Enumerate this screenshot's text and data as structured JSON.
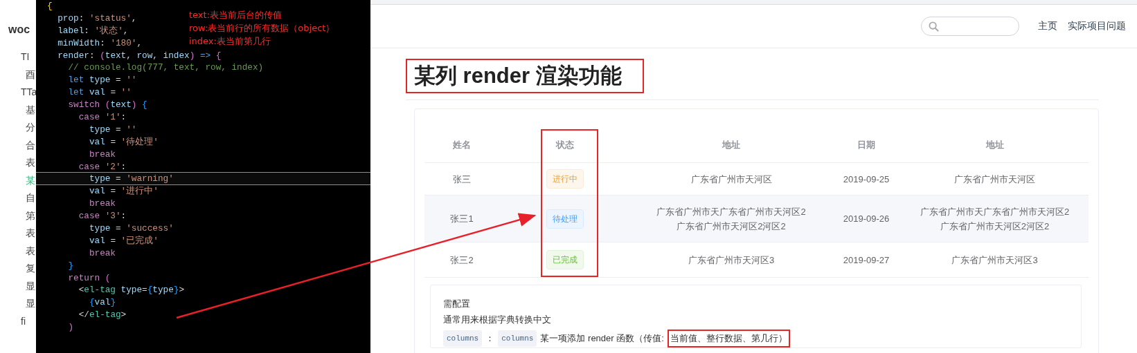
{
  "sidebar": {
    "logo": "woc",
    "items": [
      {
        "text": "TI",
        "selected": false
      },
      {
        "text": "酉",
        "selected": false
      },
      {
        "text": "TTa",
        "selected": false
      },
      {
        "text": "基",
        "selected": false
      },
      {
        "text": "分",
        "selected": false
      },
      {
        "text": "合",
        "selected": false
      },
      {
        "text": "表",
        "selected": false
      },
      {
        "text": "某",
        "selected": true
      },
      {
        "text": "自",
        "selected": false
      },
      {
        "text": "第",
        "selected": false
      },
      {
        "text": "表",
        "selected": false
      },
      {
        "text": "表",
        "selected": false
      },
      {
        "text": "复",
        "selected": false
      },
      {
        "text": "显",
        "selected": false
      },
      {
        "text": "显",
        "selected": false
      },
      {
        "text": "fi",
        "selected": false
      }
    ]
  },
  "editor": {
    "lines": [
      {
        "current": false,
        "tokens": [
          {
            "text": "{",
            "kind": "b1"
          }
        ]
      },
      {
        "current": false,
        "tokens": [
          {
            "text": "  prop",
            "kind": "k"
          },
          {
            "text": ": ",
            "kind": "p"
          },
          {
            "text": "'status'",
            "kind": "s"
          },
          {
            "text": ",",
            "kind": "p"
          }
        ]
      },
      {
        "current": false,
        "tokens": [
          {
            "text": "  label",
            "kind": "k"
          },
          {
            "text": ": ",
            "kind": "p"
          },
          {
            "text": "'状态'",
            "kind": "s"
          },
          {
            "text": ",",
            "kind": "p"
          }
        ]
      },
      {
        "current": false,
        "tokens": [
          {
            "text": "  minWidth",
            "kind": "k"
          },
          {
            "text": ": ",
            "kind": "p"
          },
          {
            "text": "'180'",
            "kind": "s"
          },
          {
            "text": ",",
            "kind": "p"
          }
        ]
      },
      {
        "current": false,
        "tokens": [
          {
            "text": "  render",
            "kind": "k"
          },
          {
            "text": ": ",
            "kind": "p"
          },
          {
            "text": "(",
            "kind": "b2"
          },
          {
            "text": "text",
            "kind": "k"
          },
          {
            "text": ", ",
            "kind": "p"
          },
          {
            "text": "row",
            "kind": "k"
          },
          {
            "text": ", ",
            "kind": "p"
          },
          {
            "text": "index",
            "kind": "k"
          },
          {
            "text": ")",
            "kind": "b2"
          },
          {
            "text": " => ",
            "kind": "kw"
          },
          {
            "text": "{",
            "kind": "b2"
          }
        ]
      },
      {
        "current": false,
        "tokens": [
          {
            "text": "    // console.log(777, text, row, index)",
            "kind": "c"
          }
        ]
      },
      {
        "current": false,
        "tokens": [
          {
            "text": "    let",
            "kind": "kw"
          },
          {
            "text": " type",
            "kind": "k"
          },
          {
            "text": " = ",
            "kind": "p"
          },
          {
            "text": "''",
            "kind": "s"
          }
        ]
      },
      {
        "current": false,
        "tokens": [
          {
            "text": "    let",
            "kind": "kw"
          },
          {
            "text": " val",
            "kind": "k"
          },
          {
            "text": " = ",
            "kind": "p"
          },
          {
            "text": "''",
            "kind": "s"
          }
        ]
      },
      {
        "current": false,
        "tokens": [
          {
            "text": "    switch",
            "kind": "ctl"
          },
          {
            "text": " (",
            "kind": "b2"
          },
          {
            "text": "text",
            "kind": "k"
          },
          {
            "text": ") ",
            "kind": "b2"
          },
          {
            "text": "{",
            "kind": "b3"
          }
        ]
      },
      {
        "current": false,
        "tokens": [
          {
            "text": "      case",
            "kind": "ctl"
          },
          {
            "text": " '1'",
            "kind": "s"
          },
          {
            "text": ":",
            "kind": "p"
          }
        ]
      },
      {
        "current": false,
        "tokens": [
          {
            "text": "        type",
            "kind": "k"
          },
          {
            "text": " = ",
            "kind": "p"
          },
          {
            "text": "''",
            "kind": "s"
          }
        ]
      },
      {
        "current": false,
        "tokens": [
          {
            "text": "        val",
            "kind": "k"
          },
          {
            "text": " = ",
            "kind": "p"
          },
          {
            "text": "'待处理'",
            "kind": "s"
          }
        ]
      },
      {
        "current": false,
        "tokens": [
          {
            "text": "        break",
            "kind": "ctl"
          }
        ]
      },
      {
        "current": false,
        "tokens": [
          {
            "text": "      case",
            "kind": "ctl"
          },
          {
            "text": " '2'",
            "kind": "s"
          },
          {
            "text": ":",
            "kind": "p"
          }
        ]
      },
      {
        "current": true,
        "tokens": [
          {
            "text": "        type",
            "kind": "k"
          },
          {
            "text": " = ",
            "kind": "p"
          },
          {
            "text": "'warning'",
            "kind": "s"
          }
        ]
      },
      {
        "current": false,
        "tokens": [
          {
            "text": "        val",
            "kind": "k"
          },
          {
            "text": " = ",
            "kind": "p"
          },
          {
            "text": "'进行中'",
            "kind": "s"
          }
        ]
      },
      {
        "current": false,
        "tokens": [
          {
            "text": "        break",
            "kind": "ctl"
          }
        ]
      },
      {
        "current": false,
        "tokens": [
          {
            "text": "      case",
            "kind": "ctl"
          },
          {
            "text": " '3'",
            "kind": "s"
          },
          {
            "text": ":",
            "kind": "p"
          }
        ]
      },
      {
        "current": false,
        "tokens": [
          {
            "text": "        type",
            "kind": "k"
          },
          {
            "text": " = ",
            "kind": "p"
          },
          {
            "text": "'success'",
            "kind": "s"
          }
        ]
      },
      {
        "current": false,
        "tokens": [
          {
            "text": "        val",
            "kind": "k"
          },
          {
            "text": " = ",
            "kind": "p"
          },
          {
            "text": "'已完成'",
            "kind": "s"
          }
        ]
      },
      {
        "current": false,
        "tokens": [
          {
            "text": "        break",
            "kind": "ctl"
          }
        ]
      },
      {
        "current": false,
        "tokens": [
          {
            "text": "    }",
            "kind": "b3"
          }
        ]
      },
      {
        "current": false,
        "tokens": [
          {
            "text": "    return",
            "kind": "ctl"
          },
          {
            "text": " (",
            "kind": "b2"
          }
        ]
      },
      {
        "current": false,
        "tokens": [
          {
            "text": "      <",
            "kind": "p"
          },
          {
            "text": "el-tag",
            "kind": "t"
          },
          {
            "text": " type",
            "kind": "k"
          },
          {
            "text": "=",
            "kind": "p"
          },
          {
            "text": "{",
            "kind": "b3"
          },
          {
            "text": "type",
            "kind": "k"
          },
          {
            "text": "}",
            "kind": "b3"
          },
          {
            "text": ">",
            "kind": "p"
          }
        ]
      },
      {
        "current": false,
        "tokens": [
          {
            "text": "        {",
            "kind": "b3"
          },
          {
            "text": "val",
            "kind": "k"
          },
          {
            "text": "}",
            "kind": "b3"
          }
        ]
      },
      {
        "current": false,
        "tokens": [
          {
            "text": "      </",
            "kind": "p"
          },
          {
            "text": "el-tag",
            "kind": "t"
          },
          {
            "text": ">",
            "kind": "p"
          }
        ]
      },
      {
        "current": false,
        "tokens": [
          {
            "text": "    )",
            "kind": "b2"
          }
        ]
      }
    ],
    "notes": [
      "text:表当前后台的传值",
      "row:表当前行的所有数据（object）",
      "index:表当前第几行"
    ]
  },
  "header": {
    "nav": [
      "主页",
      "实际项目问题"
    ]
  },
  "page_title": "某列 render 渲染功能",
  "table": {
    "columns": [
      "姓名",
      "状态",
      "地址",
      "日期",
      "地址"
    ],
    "rows": [
      {
        "name": "张三",
        "status": {
          "kind": "warning",
          "text": "进行中"
        },
        "address": [
          "广东省广州市天河区"
        ],
        "date": "2019-09-25",
        "address_2": [
          "广东省广州市天河区"
        ]
      },
      {
        "name": "张三1",
        "status": {
          "kind": "primary",
          "text": "待处理"
        },
        "address": [
          "广东省广州市天广东省广州市天河区2",
          "广东省广州市天河区2河区2"
        ],
        "date": "2019-09-26",
        "address_2": [
          "广东省广州市天广东省广州市天河区2",
          "广东省广州市天河区2河区2"
        ]
      },
      {
        "name": "张三2",
        "status": {
          "kind": "success",
          "text": "已完成"
        },
        "address": [
          "广东省广州市天河区3"
        ],
        "date": "2019-09-27",
        "address_2": [
          "广东省广州市天河区3"
        ]
      }
    ]
  },
  "config": {
    "title": "需配置",
    "description": "通常用来根据字典转换中文",
    "usage": [
      {
        "kind": "code",
        "text": "columns"
      },
      {
        "kind": "text",
        "text": "："
      },
      {
        "kind": "code",
        "text": "columns"
      },
      {
        "kind": "text",
        "text": "某一项添加 render 函数（传值: "
      },
      {
        "kind": "highlight",
        "text": "当前值、整行数据、第几行）"
      }
    ]
  }
}
